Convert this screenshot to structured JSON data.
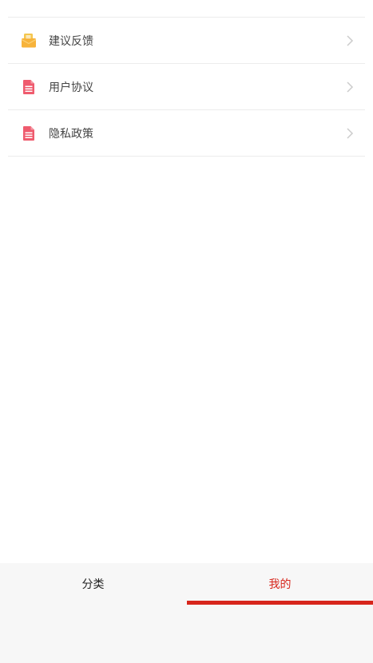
{
  "menu": {
    "items": [
      {
        "label": "建议反馈",
        "icon": "mail-icon",
        "icon_color": "#f7b33b"
      },
      {
        "label": "用户协议",
        "icon": "document-icon",
        "icon_color": "#ef5b6e"
      },
      {
        "label": "隐私政策",
        "icon": "document-icon",
        "icon_color": "#ef5b6e"
      }
    ]
  },
  "tabbar": {
    "tabs": [
      {
        "label": "分类",
        "active": false
      },
      {
        "label": "我的",
        "active": true
      }
    ],
    "accent_color": "#d7261c"
  }
}
